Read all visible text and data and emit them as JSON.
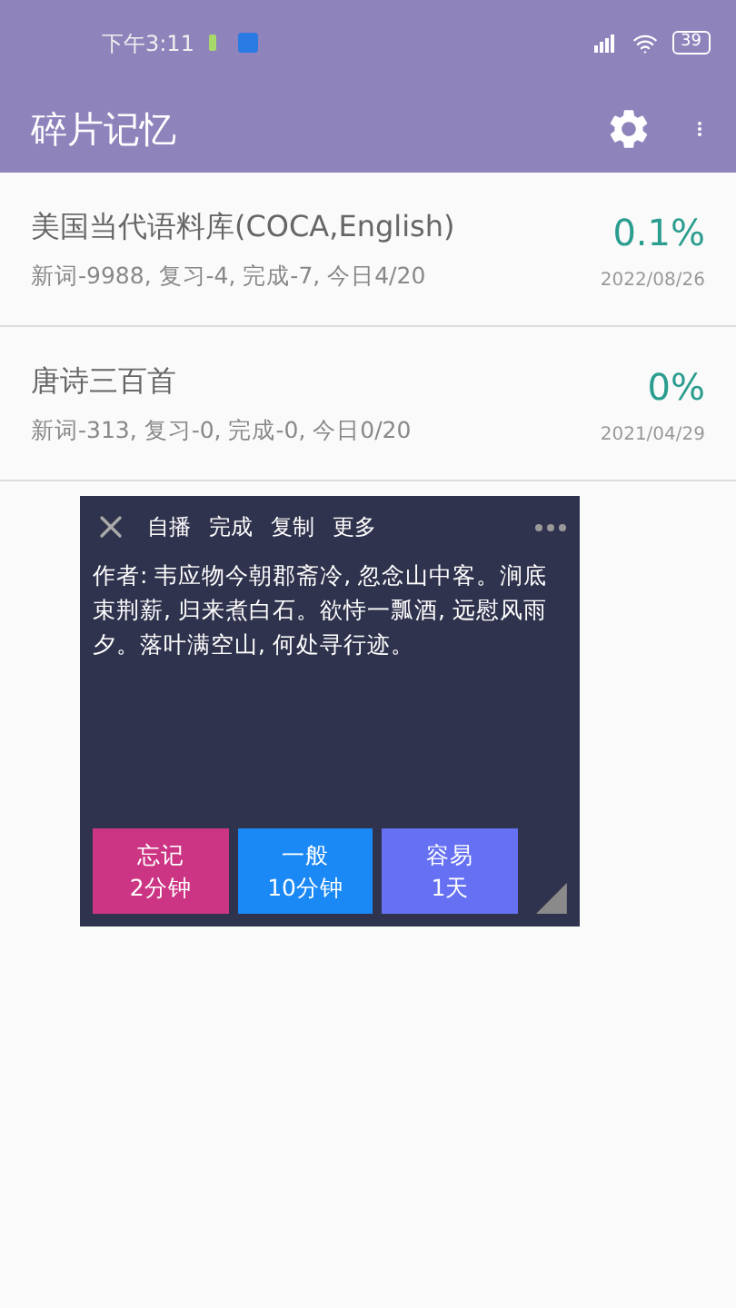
{
  "status_bar": {
    "time": "下午3:11",
    "battery": "39"
  },
  "app_bar": {
    "title": "碎片记忆"
  },
  "decks": [
    {
      "title": "美国当代语料库(COCA,English)",
      "stats": "新词-9988, 复习-4, 完成-7, 今日4/20",
      "percent": "0.1%",
      "date": "2022/08/26"
    },
    {
      "title": "唐诗三百首",
      "stats": "新词-313, 复习-0, 完成-0, 今日0/20",
      "percent": "0%",
      "date": "2021/04/29"
    }
  ],
  "popup": {
    "actions": [
      "自播",
      "完成",
      "复制",
      "更多"
    ],
    "content": "作者: 韦应物今朝郡斋冷, 忽念山中客。涧底束荆薪, 归来煮白石。欲恃一瓢酒, 远慰风雨夕。落叶满空山, 何处寻行迹。",
    "answers": [
      {
        "label": "忘记",
        "interval": "2分钟",
        "color": "#cc3584"
      },
      {
        "label": "一般",
        "interval": "10分钟",
        "color": "#1a88f5"
      },
      {
        "label": "容易",
        "interval": "1天",
        "color": "#6571f2"
      }
    ]
  }
}
